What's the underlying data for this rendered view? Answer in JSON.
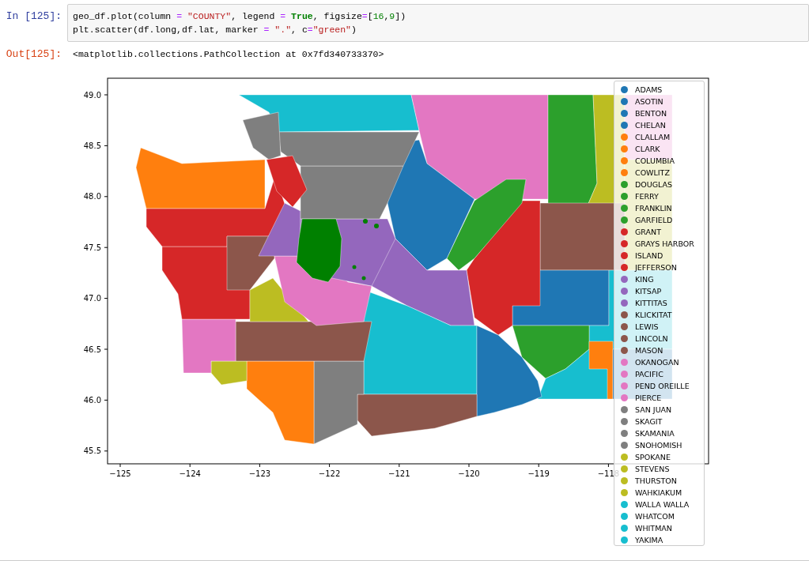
{
  "input_cell": {
    "prompt": "In [125]:",
    "lines": [
      [
        {
          "kind": "plain",
          "text": "geo_df.plot(column "
        },
        {
          "kind": "operator",
          "text": "= "
        },
        {
          "kind": "string",
          "text": "\"COUNTY\""
        },
        {
          "kind": "plain",
          "text": ", legend "
        },
        {
          "kind": "operator",
          "text": "= "
        },
        {
          "kind": "keyword",
          "text": "True"
        },
        {
          "kind": "plain",
          "text": ", figsize"
        },
        {
          "kind": "operator",
          "text": "="
        },
        {
          "kind": "plain",
          "text": "["
        },
        {
          "kind": "number",
          "text": "16"
        },
        {
          "kind": "plain",
          "text": ","
        },
        {
          "kind": "number",
          "text": "9"
        },
        {
          "kind": "plain",
          "text": "])"
        }
      ],
      [
        {
          "kind": "plain",
          "text": "plt.scatter(df.long,df.lat, marker "
        },
        {
          "kind": "operator",
          "text": "= "
        },
        {
          "kind": "string",
          "text": "\".\""
        },
        {
          "kind": "plain",
          "text": ", c"
        },
        {
          "kind": "operator",
          "text": "="
        },
        {
          "kind": "string",
          "text": "\"green\""
        },
        {
          "kind": "plain",
          "text": ")"
        }
      ]
    ]
  },
  "output_cell": {
    "prompt": "Out[125]:",
    "text": "<matplotlib.collections.PathCollection at 0x7fd340733370>"
  },
  "figure": {
    "yticks": [
      "49.0",
      "48.5",
      "48.0",
      "47.5",
      "47.0",
      "46.5",
      "46.0",
      "45.5"
    ],
    "xticks": [
      "−125",
      "−124",
      "−123",
      "−122",
      "−121",
      "−120",
      "−119",
      "−118"
    ],
    "legend": [
      {
        "label": "ADAMS",
        "color": "#1f77b4"
      },
      {
        "label": "ASOTIN",
        "color": "#1f77b4"
      },
      {
        "label": "BENTON",
        "color": "#1f77b4"
      },
      {
        "label": "CHELAN",
        "color": "#1f77b4"
      },
      {
        "label": "CLALLAM",
        "color": "#ff7f0e"
      },
      {
        "label": "CLARK",
        "color": "#ff7f0e"
      },
      {
        "label": "COLUMBIA",
        "color": "#ff7f0e"
      },
      {
        "label": "COWLITZ",
        "color": "#ff7f0e"
      },
      {
        "label": "DOUGLAS",
        "color": "#2ca02c"
      },
      {
        "label": "FERRY",
        "color": "#2ca02c"
      },
      {
        "label": "FRANKLIN",
        "color": "#2ca02c"
      },
      {
        "label": "GARFIELD",
        "color": "#2ca02c"
      },
      {
        "label": "GRANT",
        "color": "#d62728"
      },
      {
        "label": "GRAYS HARBOR",
        "color": "#d62728"
      },
      {
        "label": "ISLAND",
        "color": "#d62728"
      },
      {
        "label": "JEFFERSON",
        "color": "#d62728"
      },
      {
        "label": "KING",
        "color": "#9467bd"
      },
      {
        "label": "KITSAP",
        "color": "#9467bd"
      },
      {
        "label": "KITTITAS",
        "color": "#9467bd"
      },
      {
        "label": "KLICKITAT",
        "color": "#8c564b"
      },
      {
        "label": "LEWIS",
        "color": "#8c564b"
      },
      {
        "label": "LINCOLN",
        "color": "#8c564b"
      },
      {
        "label": "MASON",
        "color": "#8c564b"
      },
      {
        "label": "OKANOGAN",
        "color": "#e377c2"
      },
      {
        "label": "PACIFIC",
        "color": "#e377c2"
      },
      {
        "label": "PEND OREILLE",
        "color": "#e377c2"
      },
      {
        "label": "PIERCE",
        "color": "#e377c2"
      },
      {
        "label": "SAN JUAN",
        "color": "#7f7f7f"
      },
      {
        "label": "SKAGIT",
        "color": "#7f7f7f"
      },
      {
        "label": "SKAMANIA",
        "color": "#7f7f7f"
      },
      {
        "label": "SNOHOMISH",
        "color": "#7f7f7f"
      },
      {
        "label": "SPOKANE",
        "color": "#bcbd22"
      },
      {
        "label": "STEVENS",
        "color": "#bcbd22"
      },
      {
        "label": "THURSTON",
        "color": "#bcbd22"
      },
      {
        "label": "WAHKIAKUM",
        "color": "#bcbd22"
      },
      {
        "label": "WALLA WALLA",
        "color": "#17becf"
      },
      {
        "label": "WHATCOM",
        "color": "#17becf"
      },
      {
        "label": "WHITMAN",
        "color": "#17becf"
      },
      {
        "label": "YAKIMA",
        "color": "#17becf"
      }
    ]
  }
}
